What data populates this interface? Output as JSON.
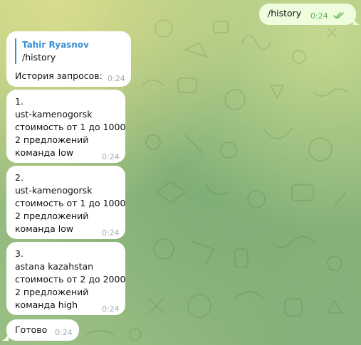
{
  "outgoing": {
    "text": "/history",
    "time": "0:24",
    "status": "read"
  },
  "reply_message": {
    "reply_to": {
      "author": "Tahir Ryasnov",
      "text": "/history"
    },
    "text": "История запросов:",
    "time": "0:24"
  },
  "history": [
    {
      "lines": [
        "1.",
        "ust-kamenogorsk",
        "стоимость от 1 до 1000",
        "2 предложений",
        "команда low"
      ],
      "time": "0:24"
    },
    {
      "lines": [
        "2.",
        "ust-kamenogorsk",
        "стоимость от 1 до 1000",
        "2 предложений",
        "команда low"
      ],
      "time": "0:24"
    },
    {
      "lines": [
        "3.",
        "astana kazahstan",
        "стоимость от 2 до 2000",
        "2 предложений",
        "команда high"
      ],
      "time": "0:24"
    }
  ],
  "done_message": {
    "text": "Готово",
    "time": "0:24"
  },
  "colors": {
    "incoming_bubble": "#ffffff",
    "outgoing_bubble": "#effdde",
    "accent": "#3a8fd3",
    "read_check": "#5db055"
  }
}
